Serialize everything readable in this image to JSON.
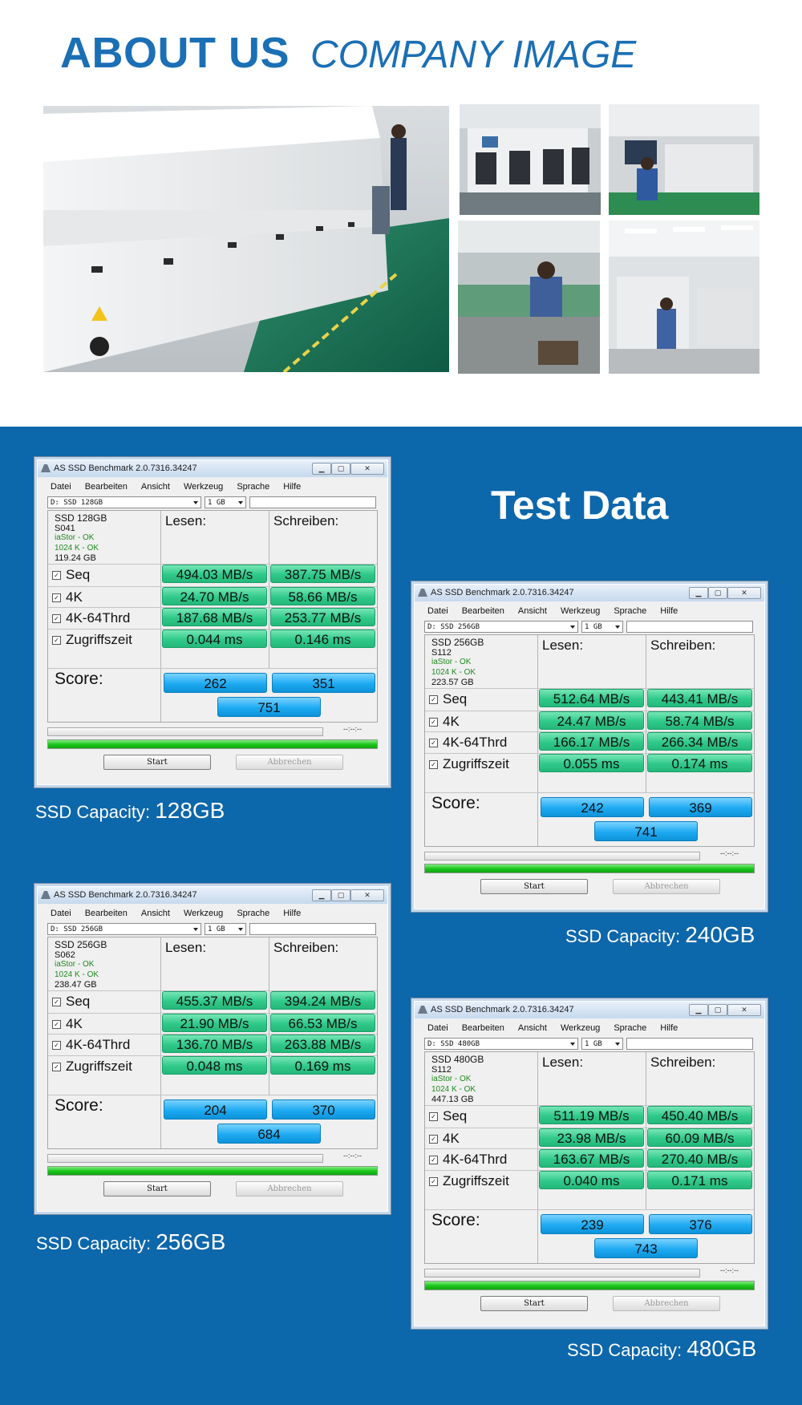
{
  "header": {
    "title_main": "ABOUT US",
    "title_sub": "COMPANY IMAGE"
  },
  "test_title": "Test Data",
  "colors": {
    "brand_blue": "#1b6fb5",
    "section_bg": "#0d67ab",
    "value_green": "#2fc98a",
    "score_blue": "#1eaaf2",
    "progress_green": "#19c419"
  },
  "windows": [
    {
      "title": "AS SSD Benchmark 2.0.7316.34247",
      "menu": [
        "Datei",
        "Bearbeiten",
        "Ansicht",
        "Werkzeug",
        "Sprache",
        "Hilfe"
      ],
      "drive_select": "D: SSD 128GB",
      "size_select": "1 GB",
      "info": {
        "name": "SSD 128GB",
        "firmware": "S041",
        "driver": "iaStor - OK",
        "align": "1024 K - OK",
        "size": "119.24 GB"
      },
      "col_read": "Lesen:",
      "col_write": "Schreiben:",
      "rows": [
        {
          "label": "Seq",
          "read": "494.03 MB/s",
          "write": "387.75 MB/s"
        },
        {
          "label": "4K",
          "read": "24.70 MB/s",
          "write": "58.66 MB/s"
        },
        {
          "label": "4K-64Thrd",
          "read": "187.68 MB/s",
          "write": "253.77 MB/s"
        },
        {
          "label": "Zugriffszeit",
          "read": "0.044 ms",
          "write": "0.146 ms"
        }
      ],
      "score_label": "Score:",
      "score_read": "262",
      "score_write": "351",
      "score_total": "751",
      "time": "--:--:--",
      "start": "Start",
      "abort": "Abbrechen",
      "capacity_label": "SSD Capacity:",
      "capacity_value": "128GB"
    },
    {
      "title": "AS SSD Benchmark 2.0.7316.34247",
      "menu": [
        "Datei",
        "Bearbeiten",
        "Ansicht",
        "Werkzeug",
        "Sprache",
        "Hilfe"
      ],
      "drive_select": "D: SSD 256GB",
      "size_select": "1 GB",
      "info": {
        "name": "SSD 256GB",
        "firmware": "S112",
        "driver": "iaStor - OK",
        "align": "1024 K - OK",
        "size": "223.57 GB"
      },
      "col_read": "Lesen:",
      "col_write": "Schreiben:",
      "rows": [
        {
          "label": "Seq",
          "read": "512.64 MB/s",
          "write": "443.41 MB/s"
        },
        {
          "label": "4K",
          "read": "24.47 MB/s",
          "write": "58.74 MB/s"
        },
        {
          "label": "4K-64Thrd",
          "read": "166.17 MB/s",
          "write": "266.34 MB/s"
        },
        {
          "label": "Zugriffszeit",
          "read": "0.055 ms",
          "write": "0.174 ms"
        }
      ],
      "score_label": "Score:",
      "score_read": "242",
      "score_write": "369",
      "score_total": "741",
      "time": "--:--:--",
      "start": "Start",
      "abort": "Abbrechen",
      "capacity_label": "SSD Capacity:",
      "capacity_value": "240GB"
    },
    {
      "title": "AS SSD Benchmark 2.0.7316.34247",
      "menu": [
        "Datei",
        "Bearbeiten",
        "Ansicht",
        "Werkzeug",
        "Sprache",
        "Hilfe"
      ],
      "drive_select": "D: SSD 256GB",
      "size_select": "1 GB",
      "info": {
        "name": "SSD 256GB",
        "firmware": "S062",
        "driver": "iaStor - OK",
        "align": "1024 K - OK",
        "size": "238.47 GB"
      },
      "col_read": "Lesen:",
      "col_write": "Schreiben:",
      "rows": [
        {
          "label": "Seq",
          "read": "455.37 MB/s",
          "write": "394.24 MB/s"
        },
        {
          "label": "4K",
          "read": "21.90 MB/s",
          "write": "66.53 MB/s"
        },
        {
          "label": "4K-64Thrd",
          "read": "136.70 MB/s",
          "write": "263.88 MB/s"
        },
        {
          "label": "Zugriffszeit",
          "read": "0.048 ms",
          "write": "0.169 ms"
        }
      ],
      "score_label": "Score:",
      "score_read": "204",
      "score_write": "370",
      "score_total": "684",
      "time": "--:--:--",
      "start": "Start",
      "abort": "Abbrechen",
      "capacity_label": "SSD Capacity:",
      "capacity_value": "256GB"
    },
    {
      "title": "AS SSD Benchmark 2.0.7316.34247",
      "menu": [
        "Datei",
        "Bearbeiten",
        "Ansicht",
        "Werkzeug",
        "Sprache",
        "Hilfe"
      ],
      "drive_select": "D: SSD 480GB",
      "size_select": "1 GB",
      "info": {
        "name": "SSD 480GB",
        "firmware": "S112",
        "driver": "iaStor - OK",
        "align": "1024 K - OK",
        "size": "447.13 GB"
      },
      "col_read": "Lesen:",
      "col_write": "Schreiben:",
      "rows": [
        {
          "label": "Seq",
          "read": "511.19 MB/s",
          "write": "450.40 MB/s"
        },
        {
          "label": "4K",
          "read": "23.98 MB/s",
          "write": "60.09 MB/s"
        },
        {
          "label": "4K-64Thrd",
          "read": "163.67 MB/s",
          "write": "270.40 MB/s"
        },
        {
          "label": "Zugriffszeit",
          "read": "0.040 ms",
          "write": "0.171 ms"
        }
      ],
      "score_label": "Score:",
      "score_read": "239",
      "score_write": "376",
      "score_total": "743",
      "time": "--:--:--",
      "start": "Start",
      "abort": "Abbrechen",
      "capacity_label": "SSD Capacity:",
      "capacity_value": "480GB"
    }
  ]
}
